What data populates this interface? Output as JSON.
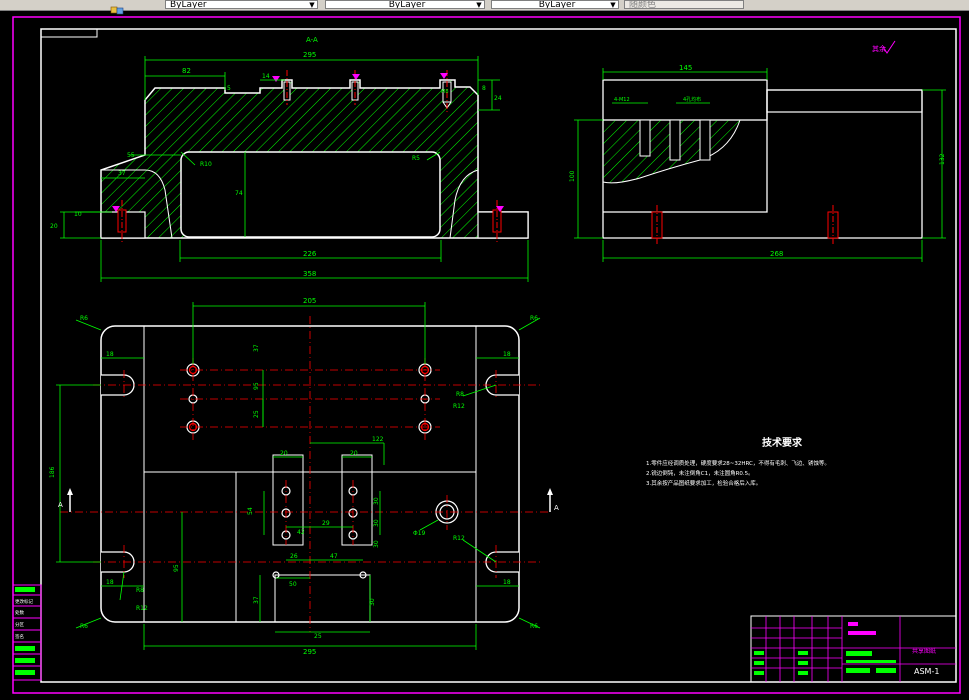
{
  "toolbar": {
    "linetype_value": "ByLayer",
    "lineweight_value": "ByLayer",
    "color_value": "ByLayer",
    "plotstyle_value": "随颜色"
  },
  "drawing": {
    "section_label": "A-A",
    "roughness_note": "其余",
    "section_dims": {
      "total_top": "295",
      "left_82": "82",
      "d14": "14",
      "d5": "5",
      "d8": "8",
      "d24": "24",
      "d55": "55",
      "r10": "R10",
      "r5": "R5",
      "d37": "37",
      "d74": "74",
      "d20": "20",
      "d10": "10",
      "d226": "226",
      "d358": "358",
      "mid_label": "M8"
    },
    "side_dims": {
      "top_145": "145",
      "m12": "4-M12",
      "mark": "4孔均布",
      "h100": "100",
      "h132": "132",
      "bottom_268": "268"
    },
    "plan_dims": {
      "d205": "205",
      "r6_tl": "R6",
      "r6_tr": "R6",
      "r6_bl": "R6",
      "r6_br": "R6",
      "d18_tl": "18",
      "d18_tr": "18",
      "d18_bl": "18",
      "d18_br": "18",
      "d37": "37",
      "d95": "95",
      "d25": "25",
      "d122": "122",
      "d20a": "20",
      "d20b": "20",
      "d54": "54",
      "d30a": "30",
      "d30b": "30",
      "d30c": "30",
      "d42": "42",
      "d29": "29",
      "d186": "186",
      "d95b": "95",
      "d26": "26",
      "d47": "47",
      "d50": "50",
      "d37b": "37",
      "d30d": "30",
      "d25b": "25",
      "d295": "295",
      "r8_r": "R8",
      "r12_r": "R12",
      "r12_r2": "R12",
      "r8_l": "R8",
      "r12_l": "R12",
      "phi19": "Φ19",
      "a_left": "A",
      "a_right": "A"
    },
    "tech_title": "技术要求",
    "tech_notes": [
      "1.零件应经调质处理，硬度要求28~32HRC，不得有毛刺、飞边、锈蚀等。",
      "2.锐边倒钝，未注倒角C1，未注圆角R0.5。",
      "3.其余按产品图纸要求加工，检验合格后入库。"
    ],
    "title_block": {
      "part_name": "共享图纸",
      "drawing_no": "ASM-1"
    },
    "revision_table": [
      "更改标记",
      "处数",
      "分区",
      "签名"
    ]
  },
  "colors": {
    "background": "#000000",
    "geometry": "#ffffff",
    "dimension": "#00ff00",
    "centerline": "#ff0000",
    "frame": "#ff00ff",
    "hatch": "#00ff00"
  }
}
